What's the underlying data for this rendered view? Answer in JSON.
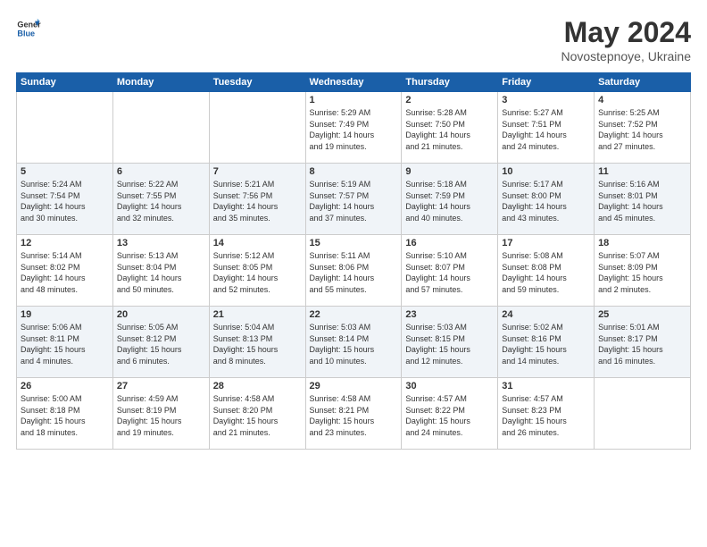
{
  "logo": {
    "general": "General",
    "blue": "Blue"
  },
  "header": {
    "month": "May 2024",
    "location": "Novostepnoye, Ukraine"
  },
  "days": [
    "Sunday",
    "Monday",
    "Tuesday",
    "Wednesday",
    "Thursday",
    "Friday",
    "Saturday"
  ],
  "weeks": [
    [
      {
        "day": "",
        "info": ""
      },
      {
        "day": "",
        "info": ""
      },
      {
        "day": "",
        "info": ""
      },
      {
        "day": "1",
        "info": "Sunrise: 5:29 AM\nSunset: 7:49 PM\nDaylight: 14 hours\nand 19 minutes."
      },
      {
        "day": "2",
        "info": "Sunrise: 5:28 AM\nSunset: 7:50 PM\nDaylight: 14 hours\nand 21 minutes."
      },
      {
        "day": "3",
        "info": "Sunrise: 5:27 AM\nSunset: 7:51 PM\nDaylight: 14 hours\nand 24 minutes."
      },
      {
        "day": "4",
        "info": "Sunrise: 5:25 AM\nSunset: 7:52 PM\nDaylight: 14 hours\nand 27 minutes."
      }
    ],
    [
      {
        "day": "5",
        "info": "Sunrise: 5:24 AM\nSunset: 7:54 PM\nDaylight: 14 hours\nand 30 minutes."
      },
      {
        "day": "6",
        "info": "Sunrise: 5:22 AM\nSunset: 7:55 PM\nDaylight: 14 hours\nand 32 minutes."
      },
      {
        "day": "7",
        "info": "Sunrise: 5:21 AM\nSunset: 7:56 PM\nDaylight: 14 hours\nand 35 minutes."
      },
      {
        "day": "8",
        "info": "Sunrise: 5:19 AM\nSunset: 7:57 PM\nDaylight: 14 hours\nand 37 minutes."
      },
      {
        "day": "9",
        "info": "Sunrise: 5:18 AM\nSunset: 7:59 PM\nDaylight: 14 hours\nand 40 minutes."
      },
      {
        "day": "10",
        "info": "Sunrise: 5:17 AM\nSunset: 8:00 PM\nDaylight: 14 hours\nand 43 minutes."
      },
      {
        "day": "11",
        "info": "Sunrise: 5:16 AM\nSunset: 8:01 PM\nDaylight: 14 hours\nand 45 minutes."
      }
    ],
    [
      {
        "day": "12",
        "info": "Sunrise: 5:14 AM\nSunset: 8:02 PM\nDaylight: 14 hours\nand 48 minutes."
      },
      {
        "day": "13",
        "info": "Sunrise: 5:13 AM\nSunset: 8:04 PM\nDaylight: 14 hours\nand 50 minutes."
      },
      {
        "day": "14",
        "info": "Sunrise: 5:12 AM\nSunset: 8:05 PM\nDaylight: 14 hours\nand 52 minutes."
      },
      {
        "day": "15",
        "info": "Sunrise: 5:11 AM\nSunset: 8:06 PM\nDaylight: 14 hours\nand 55 minutes."
      },
      {
        "day": "16",
        "info": "Sunrise: 5:10 AM\nSunset: 8:07 PM\nDaylight: 14 hours\nand 57 minutes."
      },
      {
        "day": "17",
        "info": "Sunrise: 5:08 AM\nSunset: 8:08 PM\nDaylight: 14 hours\nand 59 minutes."
      },
      {
        "day": "18",
        "info": "Sunrise: 5:07 AM\nSunset: 8:09 PM\nDaylight: 15 hours\nand 2 minutes."
      }
    ],
    [
      {
        "day": "19",
        "info": "Sunrise: 5:06 AM\nSunset: 8:11 PM\nDaylight: 15 hours\nand 4 minutes."
      },
      {
        "day": "20",
        "info": "Sunrise: 5:05 AM\nSunset: 8:12 PM\nDaylight: 15 hours\nand 6 minutes."
      },
      {
        "day": "21",
        "info": "Sunrise: 5:04 AM\nSunset: 8:13 PM\nDaylight: 15 hours\nand 8 minutes."
      },
      {
        "day": "22",
        "info": "Sunrise: 5:03 AM\nSunset: 8:14 PM\nDaylight: 15 hours\nand 10 minutes."
      },
      {
        "day": "23",
        "info": "Sunrise: 5:03 AM\nSunset: 8:15 PM\nDaylight: 15 hours\nand 12 minutes."
      },
      {
        "day": "24",
        "info": "Sunrise: 5:02 AM\nSunset: 8:16 PM\nDaylight: 15 hours\nand 14 minutes."
      },
      {
        "day": "25",
        "info": "Sunrise: 5:01 AM\nSunset: 8:17 PM\nDaylight: 15 hours\nand 16 minutes."
      }
    ],
    [
      {
        "day": "26",
        "info": "Sunrise: 5:00 AM\nSunset: 8:18 PM\nDaylight: 15 hours\nand 18 minutes."
      },
      {
        "day": "27",
        "info": "Sunrise: 4:59 AM\nSunset: 8:19 PM\nDaylight: 15 hours\nand 19 minutes."
      },
      {
        "day": "28",
        "info": "Sunrise: 4:58 AM\nSunset: 8:20 PM\nDaylight: 15 hours\nand 21 minutes."
      },
      {
        "day": "29",
        "info": "Sunrise: 4:58 AM\nSunset: 8:21 PM\nDaylight: 15 hours\nand 23 minutes."
      },
      {
        "day": "30",
        "info": "Sunrise: 4:57 AM\nSunset: 8:22 PM\nDaylight: 15 hours\nand 24 minutes."
      },
      {
        "day": "31",
        "info": "Sunrise: 4:57 AM\nSunset: 8:23 PM\nDaylight: 15 hours\nand 26 minutes."
      },
      {
        "day": "",
        "info": ""
      }
    ]
  ]
}
